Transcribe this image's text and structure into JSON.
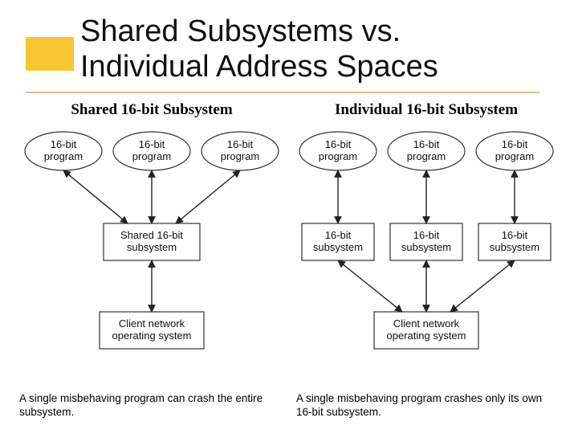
{
  "title_line1": "Shared Subsystems vs.",
  "title_line2": "Individual Address Spaces",
  "left": {
    "heading": "Shared 16-bit Subsystem",
    "programs": [
      "16-bit program",
      "16-bit program",
      "16-bit program"
    ],
    "shared_box": "Shared 16-bit subsystem",
    "client_box": "Client network operating system",
    "caption": "A single misbehaving program can crash the entire subsystem."
  },
  "right": {
    "heading": "Individual 16-bit Subsystem",
    "programs": [
      "16-bit program",
      "16-bit program",
      "16-bit program"
    ],
    "sub_boxes": [
      "16-bit subsystem",
      "16-bit subsystem",
      "16-bit subsystem"
    ],
    "client_box": "Client network operating system",
    "caption": "A single misbehaving program crashes only its own 16-bit subsystem."
  }
}
